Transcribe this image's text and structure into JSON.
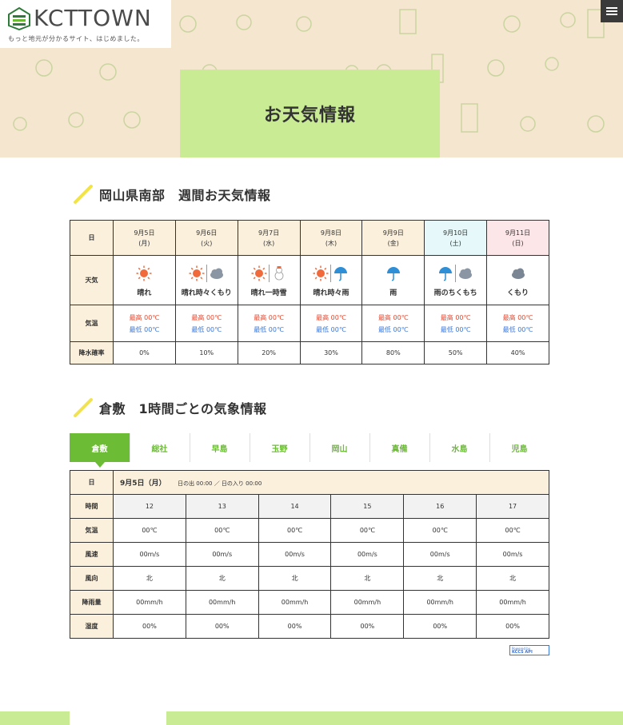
{
  "header": {
    "logo_text": "KCTTOWN",
    "tagline": "もっと地元が分かるサイト、はじめました。",
    "page_title": "お天気情報"
  },
  "weekly": {
    "heading": "岡山県南部　週間お天気情報",
    "labels": {
      "day": "日",
      "weather": "天気",
      "temp": "気温",
      "rain": "降水確率"
    },
    "days": [
      {
        "date": "9月5日",
        "dow": "(月)",
        "weather": "晴れ",
        "icons": [
          "sun"
        ],
        "hi": "最高 00℃",
        "lo": "最低 00℃",
        "rain": "0%"
      },
      {
        "date": "9月6日",
        "dow": "(火)",
        "weather": "晴れ時々くもり",
        "icons": [
          "sun",
          "cloud"
        ],
        "hi": "最高 00℃",
        "lo": "最低 00℃",
        "rain": "10%"
      },
      {
        "date": "9月7日",
        "dow": "(水)",
        "weather": "晴れ一時雪",
        "icons": [
          "sun",
          "snow"
        ],
        "hi": "最高 00℃",
        "lo": "最低 00℃",
        "rain": "20%"
      },
      {
        "date": "9月8日",
        "dow": "(木)",
        "weather": "晴れ時々雨",
        "icons": [
          "sun",
          "umbrella"
        ],
        "hi": "最高 00℃",
        "lo": "最低 00℃",
        "rain": "30%"
      },
      {
        "date": "9月9日",
        "dow": "(金)",
        "weather": "雨",
        "icons": [
          "umbrella"
        ],
        "hi": "最高 00℃",
        "lo": "最低 00℃",
        "rain": "80%"
      },
      {
        "date": "9月10日",
        "dow": "(土)",
        "weather": "雨のちくもち",
        "icons": [
          "umbrella",
          "cloud"
        ],
        "hi": "最高 00℃",
        "lo": "最低 00℃",
        "rain": "50%"
      },
      {
        "date": "9月11日",
        "dow": "(日)",
        "weather": "くもり",
        "icons": [
          "cloud-dark"
        ],
        "hi": "最高 00℃",
        "lo": "最低 00℃",
        "rain": "40%"
      }
    ]
  },
  "hourly": {
    "heading": "倉敷　1時間ごとの気象情報",
    "tabs": [
      "倉敷",
      "総社",
      "早島",
      "玉野",
      "岡山",
      "真備",
      "水島",
      "児島"
    ],
    "active_tab": "倉敷",
    "date_label": "日",
    "date": "9月5日（月）",
    "sun_info": "日の出 00:00 ／ 日の入り 00:00",
    "row_labels": {
      "time": "時間",
      "temp": "気温",
      "wind_speed": "風速",
      "wind_dir": "風向",
      "precip": "降雨量",
      "humidity": "湿度"
    },
    "hours": [
      {
        "time": "12",
        "temp": "00℃",
        "wind_speed": "00m/s",
        "wind_dir": "北",
        "precip": "00mm/h",
        "humidity": "00%"
      },
      {
        "time": "13",
        "temp": "00℃",
        "wind_speed": "00m/s",
        "wind_dir": "北",
        "precip": "00mm/h",
        "humidity": "00%"
      },
      {
        "time": "14",
        "temp": "00℃",
        "wind_speed": "00m/s",
        "wind_dir": "北",
        "precip": "00mm/h",
        "humidity": "00%"
      },
      {
        "time": "15",
        "temp": "00℃",
        "wind_speed": "00m/s",
        "wind_dir": "北",
        "precip": "00mm/h",
        "humidity": "00%"
      },
      {
        "time": "16",
        "temp": "00℃",
        "wind_speed": "00m/s",
        "wind_dir": "北",
        "precip": "00mm/h",
        "humidity": "00%"
      },
      {
        "time": "17",
        "temp": "00℃",
        "wind_speed": "00m/s",
        "wind_dir": "北",
        "precip": "00mm/h",
        "humidity": "00%"
      }
    ]
  },
  "powered": {
    "line1": "Powered by",
    "line2": "KCCS API"
  },
  "colors": {
    "accent_green": "#6cbc35",
    "light_green": "#c8eb93",
    "hero_bg": "#f5e6cf",
    "label_bg": "#fbf0dc",
    "high_red": "#e8452b",
    "low_blue": "#3a76d8"
  }
}
